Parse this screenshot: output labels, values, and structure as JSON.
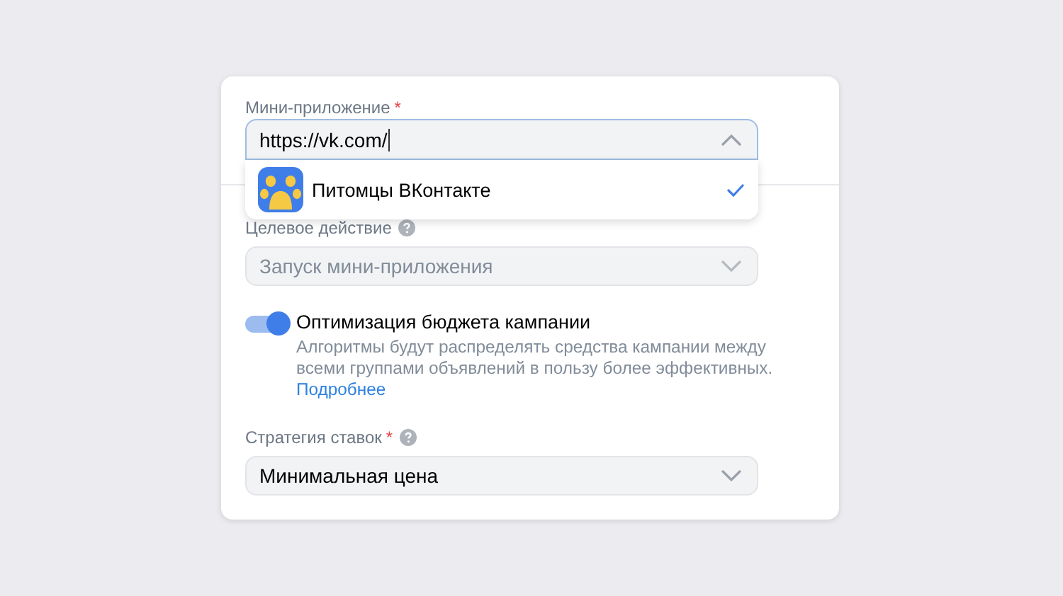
{
  "mini_app": {
    "label": "Мини-приложение",
    "required_mark": "*",
    "value": "https://vk.com/",
    "expanded": true,
    "options": [
      {
        "name": "Питомцы ВКонтакте",
        "selected": true
      }
    ]
  },
  "target_action": {
    "label": "Целевое действие",
    "help": true,
    "value": "Запуск мини-приложения",
    "disabled": true
  },
  "budget_optimization": {
    "label": "Оптимизация бюджета кампании",
    "on": true,
    "description": "Алгоритмы будут распределять средства кампании между всеми группами объявлений в пользу более эффективных.",
    "link": "Подробнее"
  },
  "bid_strategy": {
    "label": "Стратегия ставок",
    "required_mark": "*",
    "help": true,
    "value": "Минимальная цена",
    "disabled": false
  }
}
